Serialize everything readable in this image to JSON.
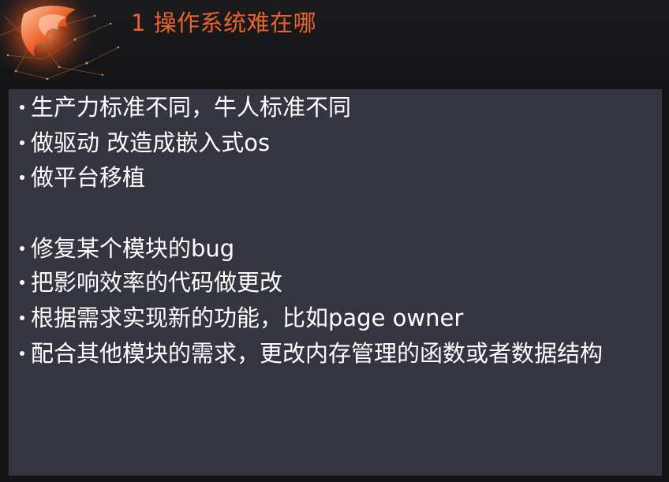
{
  "title": "1 操作系统难在哪",
  "bullets": [
    " 生产力标准不同，牛人标准不同",
    "做驱动 改造成嵌入式os",
    "做平台移植",
    "修复某个模块的bug",
    "把影响效率的代码做更改",
    "根据需求实现新的功能，比如page owner",
    "配合其他模块的需求，更改内存管理的函数或者数据结构"
  ],
  "colors": {
    "title": "#e8642c",
    "content_background": "#34353e",
    "page_background": "#141416",
    "text": "#ffffff"
  },
  "icons": {
    "logo": "flame-orb-logo"
  }
}
